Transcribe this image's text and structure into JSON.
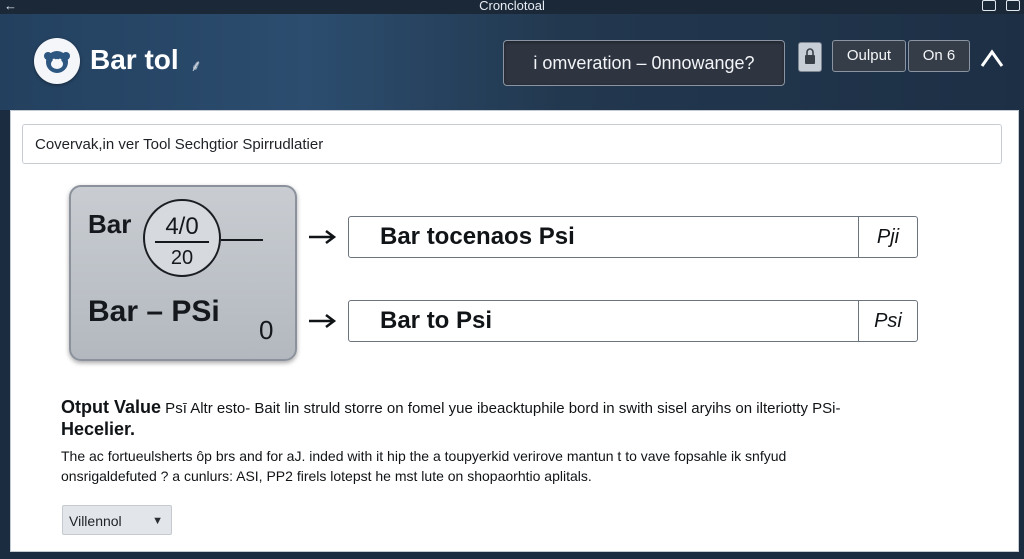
{
  "window": {
    "title": "Cronclotoal"
  },
  "header": {
    "app_title": "Bar tol",
    "title_glyph": "⸙",
    "search_text": "i omveration – 0nnowange?",
    "output_label": "Oulput",
    "on_label": "On 6"
  },
  "main": {
    "section_title": "Covervak,in ver Tool Sechgtior Spirrudlatier",
    "card": {
      "bar_label": "Bar",
      "gauge_top": "4/0",
      "gauge_bottom": "20",
      "formula": "Bar  –  PSi",
      "formula_sub": "0"
    },
    "results": [
      {
        "text": "Bar  tocenaos Psi",
        "unit": "Pji"
      },
      {
        "text": "Bar   to Psi",
        "unit": "Psi"
      }
    ],
    "output": {
      "heading_bold": "Otput Value",
      "heading_mid": " Psī",
      "heading_rest": " Altr esto- Bait lin struld storre on fomel yue ibeacktuphile bord in swith sisel aryihs on ilteriotty PSi-",
      "heading_bold2": "Hecelier."
    },
    "description_line1": "The ac fortueulsherts ôp brs and for aJ. inded with it hip the a toupyerkid verirove mantun t to vave fopsahle ik snfyud",
    "description_line2": "onsrigaldefuted ? a cunlurs: ASI, PP2 firels lotepst he mst lute on shopaorhtio aplitals.",
    "dropdown_value": "Villennol"
  },
  "icons": {
    "logo": "sheep-logo-icon",
    "back": "back-arrow-icon",
    "lock": "lock-icon",
    "chevron": "chevron-up-icon",
    "arrow": "right-arrow-icon"
  }
}
